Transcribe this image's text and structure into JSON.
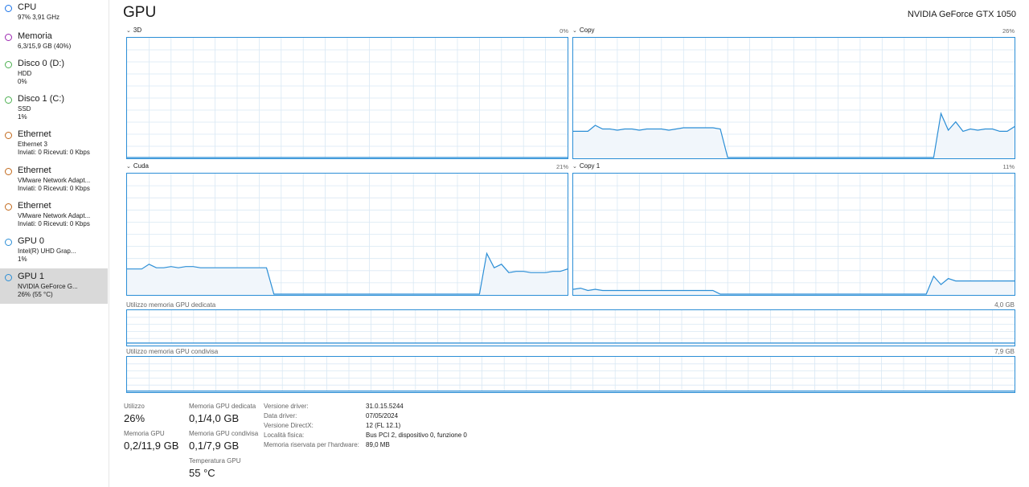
{
  "sidebar": {
    "items": [
      {
        "title": "CPU",
        "line1": "97% 3,91 GHz",
        "line2": "",
        "color": "#1a73e8"
      },
      {
        "title": "Memoria",
        "line1": "6,3/15,9 GB (40%)",
        "line2": "",
        "color": "#9c27b0"
      },
      {
        "title": "Disco 0 (D:)",
        "line1": "HDD",
        "line2": "0%",
        "color": "#4caf50"
      },
      {
        "title": "Disco 1 (C:)",
        "line1": "SSD",
        "line2": "1%",
        "color": "#4caf50"
      },
      {
        "title": "Ethernet",
        "line1": "Ethernet 3",
        "line2": "Inviati: 0 Ricevuti: 0 Kbps",
        "color": "#c2691b"
      },
      {
        "title": "Ethernet",
        "line1": "VMware Network Adapt...",
        "line2": "Inviati: 0 Ricevuti: 0 Kbps",
        "color": "#c2691b"
      },
      {
        "title": "Ethernet",
        "line1": "VMware Network Adapt...",
        "line2": "Inviati: 0 Ricevuti: 0 Kbps",
        "color": "#c2691b"
      },
      {
        "title": "GPU 0",
        "line1": "Intel(R) UHD Grap...",
        "line2": "1%",
        "color": "#2b8ed6"
      },
      {
        "title": "GPU 1",
        "line1": "NVIDIA GeForce G...",
        "line2": "26% (55 °C)",
        "color": "#2b8ed6"
      }
    ]
  },
  "header": {
    "title": "GPU",
    "device": "NVIDIA GeForce GTX 1050"
  },
  "graphs": {
    "g3d": {
      "label": "3D",
      "value": "0%",
      "util": [
        0,
        0,
        0,
        0,
        0,
        0,
        0,
        0,
        0,
        0,
        0,
        0,
        0,
        0,
        0,
        0,
        0,
        0,
        0,
        0,
        0,
        0,
        0,
        0,
        0,
        0,
        0,
        0,
        0,
        0,
        0,
        0,
        0,
        0,
        0,
        0,
        0,
        0,
        0,
        0,
        0,
        0,
        0,
        0,
        0,
        0,
        0,
        0,
        0,
        0,
        0,
        0,
        0,
        0,
        0,
        0,
        0,
        0,
        0,
        0,
        0
      ]
    },
    "copy": {
      "label": "Copy",
      "value": "26%",
      "util": [
        22,
        22,
        22,
        27,
        24,
        24,
        23,
        24,
        24,
        23,
        24,
        24,
        24,
        23,
        24,
        25,
        25,
        25,
        25,
        25,
        24,
        0,
        0,
        0,
        0,
        0,
        0,
        0,
        0,
        0,
        0,
        0,
        0,
        0,
        0,
        0,
        0,
        0,
        0,
        0,
        0,
        0,
        0,
        0,
        0,
        0,
        0,
        0,
        0,
        0,
        37,
        23,
        30,
        22,
        24,
        23,
        24,
        24,
        22,
        22,
        26
      ]
    },
    "cuda": {
      "label": "Cuda",
      "value": "21%",
      "util": [
        21,
        21,
        21,
        25,
        22,
        22,
        23,
        22,
        23,
        23,
        22,
        22,
        22,
        22,
        22,
        22,
        22,
        22,
        22,
        22,
        0,
        0,
        0,
        0,
        0,
        0,
        0,
        0,
        0,
        0,
        0,
        0,
        0,
        0,
        0,
        0,
        0,
        0,
        0,
        0,
        0,
        0,
        0,
        0,
        0,
        0,
        0,
        0,
        0,
        34,
        22,
        25,
        18,
        19,
        19,
        18,
        18,
        18,
        19,
        19,
        21
      ]
    },
    "copy1": {
      "label": "Copy 1",
      "value": "11%",
      "util": [
        4,
        5,
        3,
        4,
        3,
        3,
        3,
        3,
        3,
        3,
        3,
        3,
        3,
        3,
        3,
        3,
        3,
        3,
        3,
        3,
        0,
        0,
        0,
        0,
        0,
        0,
        0,
        0,
        0,
        0,
        0,
        0,
        0,
        0,
        0,
        0,
        0,
        0,
        0,
        0,
        0,
        0,
        0,
        0,
        0,
        0,
        0,
        0,
        0,
        15,
        8,
        13,
        11,
        11,
        11,
        11,
        11,
        11,
        11,
        11,
        11
      ]
    }
  },
  "memory": {
    "dedicated": {
      "label": "Utilizzo memoria GPU dedicata",
      "max": "4,0 GB",
      "util": [
        5,
        5,
        5,
        5,
        5,
        5,
        5,
        5,
        5,
        5,
        5,
        5,
        5,
        5,
        5,
        5,
        5,
        5,
        5,
        5,
        5,
        5,
        5,
        5,
        5,
        5,
        5,
        5,
        5,
        5,
        5,
        5,
        5,
        5,
        5,
        5,
        5,
        5,
        5,
        5,
        5,
        5,
        5,
        5,
        5,
        5,
        5,
        5,
        5,
        5,
        5,
        5,
        5,
        5,
        5,
        5,
        5,
        5,
        5,
        5,
        5
      ]
    },
    "shared": {
      "label": "Utilizzo memoria GPU condivisa",
      "max": "7,9 GB",
      "util": [
        1,
        1,
        1,
        1,
        1,
        1,
        1,
        1,
        1,
        1,
        1,
        1,
        1,
        1,
        1,
        1,
        1,
        1,
        1,
        1,
        1,
        1,
        1,
        1,
        1,
        1,
        1,
        1,
        1,
        1,
        1,
        1,
        1,
        1,
        1,
        1,
        1,
        1,
        1,
        1,
        1,
        1,
        1,
        1,
        1,
        1,
        1,
        1,
        1,
        1,
        1,
        1,
        1,
        1,
        1,
        1,
        1,
        1,
        1,
        1,
        1
      ]
    }
  },
  "stats": {
    "utilizzo_label": "Utilizzo",
    "utilizzo": "26%",
    "ded_label": "Memoria GPU dedicata",
    "ded": "0,1/4,0 GB",
    "mem_label": "Memoria GPU",
    "mem": "0,2/11,9 GB",
    "sh_label": "Memoria GPU condivisa",
    "sh": "0,1/7,9 GB",
    "temp_label": "Temperatura GPU",
    "temp": "55 °C"
  },
  "info": [
    {
      "label": "Versione driver:",
      "value": "31.0.15.5244"
    },
    {
      "label": "Data driver:",
      "value": "07/05/2024"
    },
    {
      "label": "Versione DirectX:",
      "value": "12 (FL 12.1)"
    },
    {
      "label": "Località fisica:",
      "value": "Bus PCI 2, dispositivo 0, funzione 0"
    },
    {
      "label": "Memoria riservata per l'hardware:",
      "value": "89,0 MB"
    }
  ],
  "colors": {
    "accent": "#2b8ed6",
    "fill": "#f1f6fb",
    "grid": "#d9e8f4",
    "selected": "#d9d9d9"
  }
}
